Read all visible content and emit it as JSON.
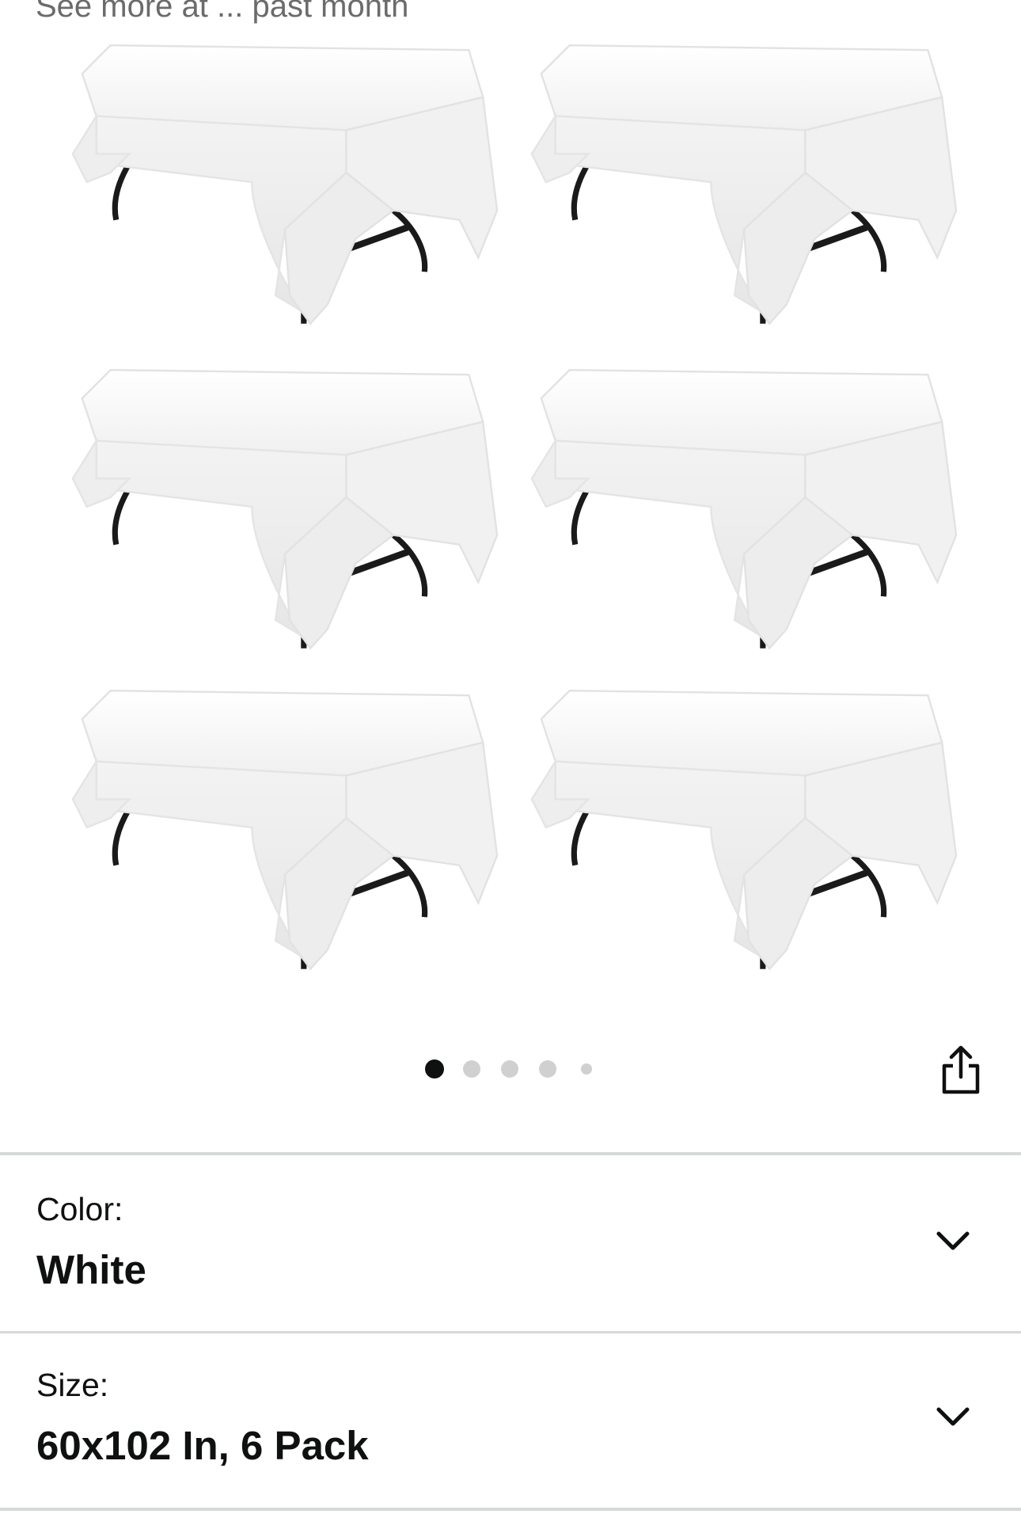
{
  "header_partial_text": "See more at ... past month",
  "gallery": {
    "total_images": 5,
    "current_index": 1,
    "image_description": "six-tablecloth-product-image"
  },
  "colors": {
    "dot_active": "#0f1111",
    "dot_inactive": "#d0d0d0",
    "divider": "#d5d9d9"
  },
  "options": {
    "color": {
      "label": "Color:",
      "value": "White"
    },
    "size": {
      "label": "Size:",
      "value": "60x102 In, 6 Pack"
    }
  },
  "icons": {
    "share": "share-icon",
    "chevron": "chevron-down-icon"
  }
}
